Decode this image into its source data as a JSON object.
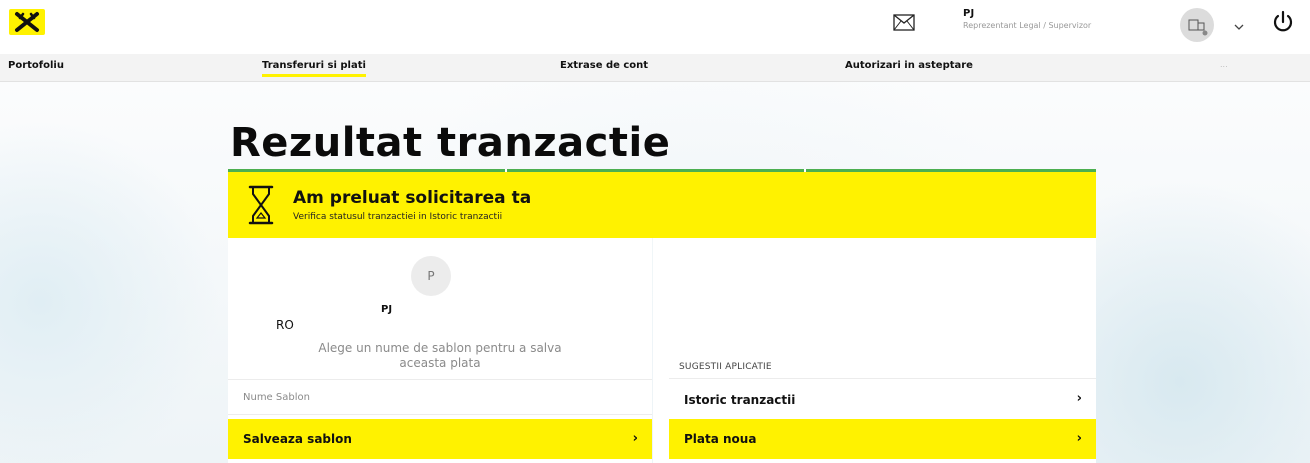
{
  "header": {
    "user_name": "PJ",
    "user_role": "Reprezentant Legal / Supervizor"
  },
  "nav": {
    "items": [
      {
        "label": "Portofoliu"
      },
      {
        "label": "Transferuri si plati",
        "active": true
      },
      {
        "label": "Extrase de cont"
      },
      {
        "label": "Autorizari in asteptare"
      }
    ],
    "more": "..."
  },
  "page": {
    "title": "Rezultat tranzactie"
  },
  "banner": {
    "title": "Am preluat solicitarea ta",
    "subtitle": "Verifica statusul tranzactiei in Istoric tranzactii"
  },
  "beneficiary": {
    "initial": "P",
    "name": "PJ",
    "country": "RO"
  },
  "template": {
    "hint_line1": "Alege un nume de sablon pentru a salva",
    "hint_line2": "aceasta plata",
    "input_placeholder": "Nume Sablon",
    "input_value": "",
    "save_label": "Salveaza sablon"
  },
  "suggestions": {
    "heading": "SUGESTII APLICATIE",
    "history_label": "Istoric tranzactii",
    "new_payment_label": "Plata noua"
  },
  "icons": {
    "logo": "raiffeisen-logo-icon",
    "mail": "envelope-icon",
    "avatar": "company-avatar-icon",
    "dropdown": "chevron-down-icon",
    "power": "power-icon",
    "status": "hourglass-icon",
    "arrow": "chevron-right-icon"
  },
  "colors": {
    "brand_yellow": "#fff200",
    "progress_green": "#4caf50",
    "text_dark": "#111111",
    "muted_text": "#8a8a8a"
  }
}
